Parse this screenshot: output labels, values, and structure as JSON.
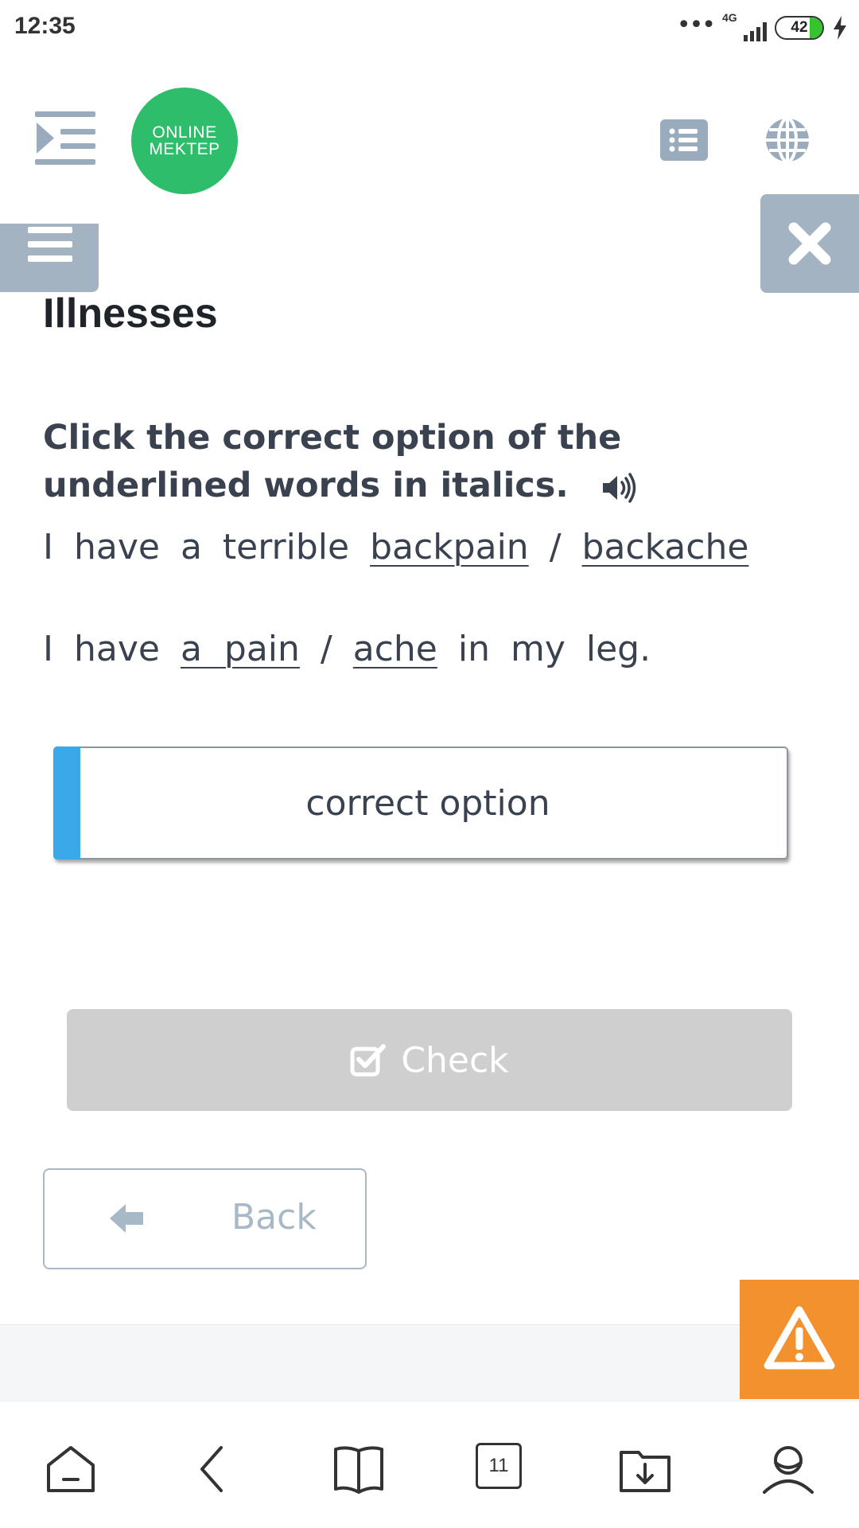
{
  "status_bar": {
    "time": "12:35",
    "network": "4G",
    "battery": "42"
  },
  "header": {
    "logo_line1": "ONLINE",
    "logo_line2": "MEKTEP"
  },
  "page_title": "Illnesses",
  "instruction": "Click the correct option of the underlined words in italics.",
  "sentences": [
    {
      "words_before": [
        "I",
        "have",
        "a",
        "terrible"
      ],
      "option_a": "backpain",
      "separator": "/",
      "option_b": "backache",
      "words_after": []
    },
    {
      "words_before": [
        "I",
        "have"
      ],
      "option_a": "a  pain",
      "separator": "/",
      "option_b": "ache",
      "words_after": [
        "in",
        "my",
        "leg."
      ]
    }
  ],
  "answer_box": {
    "label": "correct option"
  },
  "check_button": {
    "label": "Check"
  },
  "back_button": {
    "label": "Back"
  },
  "bottom_nav": {
    "tabs_count": "11"
  },
  "colors": {
    "logo": "#2ebd6b",
    "panel_button": "#a3b3c2",
    "answer_stripe": "#3aa9ea",
    "check_disabled": "#cfcfcf",
    "warning": "#f3912f"
  }
}
